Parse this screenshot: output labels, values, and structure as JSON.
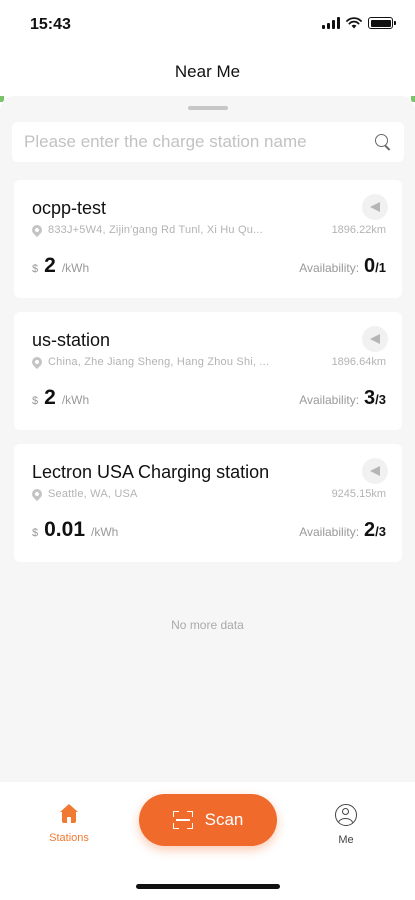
{
  "status_bar": {
    "time": "15:43"
  },
  "header": {
    "title": "Near Me"
  },
  "search": {
    "placeholder": "Please enter the charge station name"
  },
  "stations": [
    {
      "name": "ocpp-test",
      "address": "833J+5W4, Zijin'gang Rd Tunl, Xi Hu Qu...",
      "distance": "1896.22km",
      "currency": "$",
      "price": "2",
      "unit": "/kWh",
      "availability_label": "Availability:",
      "available": "0",
      "total": "/1"
    },
    {
      "name": "us-station",
      "address": "China, Zhe Jiang Sheng, Hang Zhou Shi, ...",
      "distance": "1896.64km",
      "currency": "$",
      "price": "2",
      "unit": "/kWh",
      "availability_label": "Availability:",
      "available": "3",
      "total": "/3"
    },
    {
      "name": "Lectron USA Charging station",
      "address": "Seattle, WA, USA",
      "distance": "9245.15km",
      "currency": "$",
      "price": "0.01",
      "unit": "/kWh",
      "availability_label": "Availability:",
      "available": "2",
      "total": "/3"
    }
  ],
  "list_footer": "No more data",
  "tab_bar": {
    "stations_label": "Stations",
    "scan_label": "Scan",
    "me_label": "Me",
    "active_color": "#f07a32"
  },
  "colors": {
    "accent": "#f06a2c",
    "background": "#f6f6f6"
  },
  "icons": [
    "search-icon",
    "navigate-arrow-icon",
    "location-pin-icon",
    "home-icon",
    "scan-icon",
    "user-icon"
  ]
}
